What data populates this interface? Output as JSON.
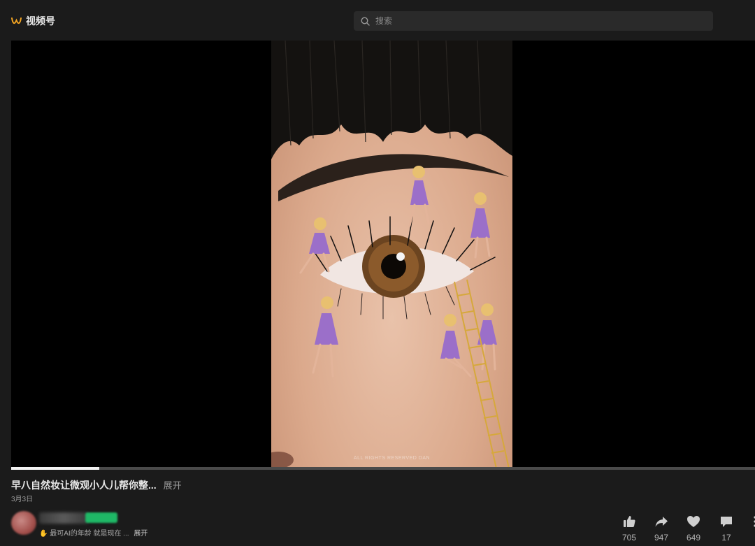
{
  "header": {
    "logo_text": "视频号",
    "search_placeholder": "搜索"
  },
  "player": {
    "watermark": "ALL RIGHTS RESERVED DAN",
    "progress": 0.118
  },
  "video": {
    "title": "早八自然妆让微观小人儿帮你整...",
    "expand_label": "展开",
    "date": "3月3日"
  },
  "author": {
    "description": "最可AI的年龄 就是现在 ...",
    "expand_label": "展开"
  },
  "actions": [
    {
      "name": "like",
      "icon": "thumbs-up-icon",
      "count": "705"
    },
    {
      "name": "share",
      "icon": "share-icon",
      "count": "947"
    },
    {
      "name": "favorite",
      "icon": "heart-icon",
      "count": "649"
    },
    {
      "name": "comment",
      "icon": "comment-icon",
      "count": "17"
    }
  ],
  "colors": {
    "background": "#1b1b1b",
    "logo_accent": "#f5a623",
    "badge_green": "#1fb866"
  }
}
